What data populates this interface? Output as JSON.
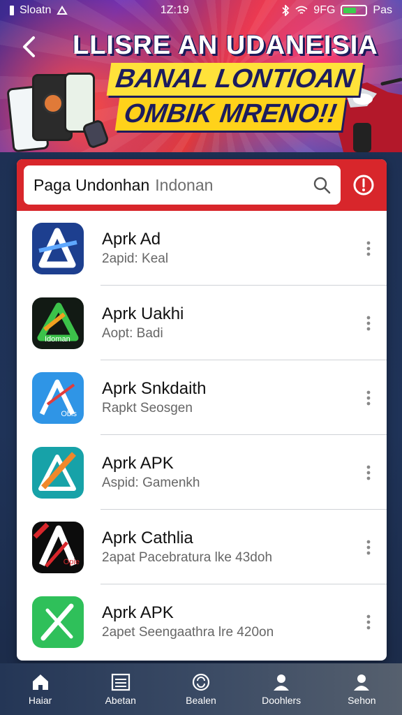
{
  "status_bar": {
    "left_text": "Sloatn",
    "time": "1Z:19",
    "right_text": "9FG",
    "end_text": "Pas"
  },
  "banner": {
    "title": "LLISRE AN UDANEISIA",
    "subtitle_1": "BANAL LONTIOAN",
    "subtitle_2": "OMBIK MRENO!!"
  },
  "search": {
    "label": "Paga Undonhan",
    "hint": "Indonan"
  },
  "apps": [
    {
      "name": "Aprk Ad",
      "subtitle": "2apid: Keal",
      "icon": "blue-a-logo-icon"
    },
    {
      "name": "Aprk Uakhi",
      "subtitle": "Aopt: Badi",
      "icon": "green-a-logo-icon",
      "icon_text": "Idoman"
    },
    {
      "name": "Aprk Snkdaith",
      "subtitle": "Rapkt Seosgen",
      "icon": "light-blue-a-logo-icon",
      "icon_text": "Obis"
    },
    {
      "name": "Aprk APK",
      "subtitle": "Aspid: Gamenkh",
      "icon": "teal-a-logo-icon"
    },
    {
      "name": "Aprk Cathlia",
      "subtitle": "2apat Pacebratura lke 43doh",
      "icon": "black-red-a-logo-icon",
      "icon_text": "Opie"
    },
    {
      "name": "Aprk APK",
      "subtitle": "2apet Seengaathra lre 420on",
      "icon": "green-x-logo-icon"
    }
  ],
  "bottom_nav": [
    {
      "label": "Haiar",
      "icon": "home-icon"
    },
    {
      "label": "Abetan",
      "icon": "list-icon"
    },
    {
      "label": "Bealen",
      "icon": "refresh-icon"
    },
    {
      "label": "Doohlers",
      "icon": "user-icon"
    },
    {
      "label": "Sehon",
      "icon": "profile-icon"
    }
  ],
  "colors": {
    "accent_red": "#d8262b",
    "banner_yellow": "#ffe23a",
    "nav_bg": "#2f4058"
  }
}
